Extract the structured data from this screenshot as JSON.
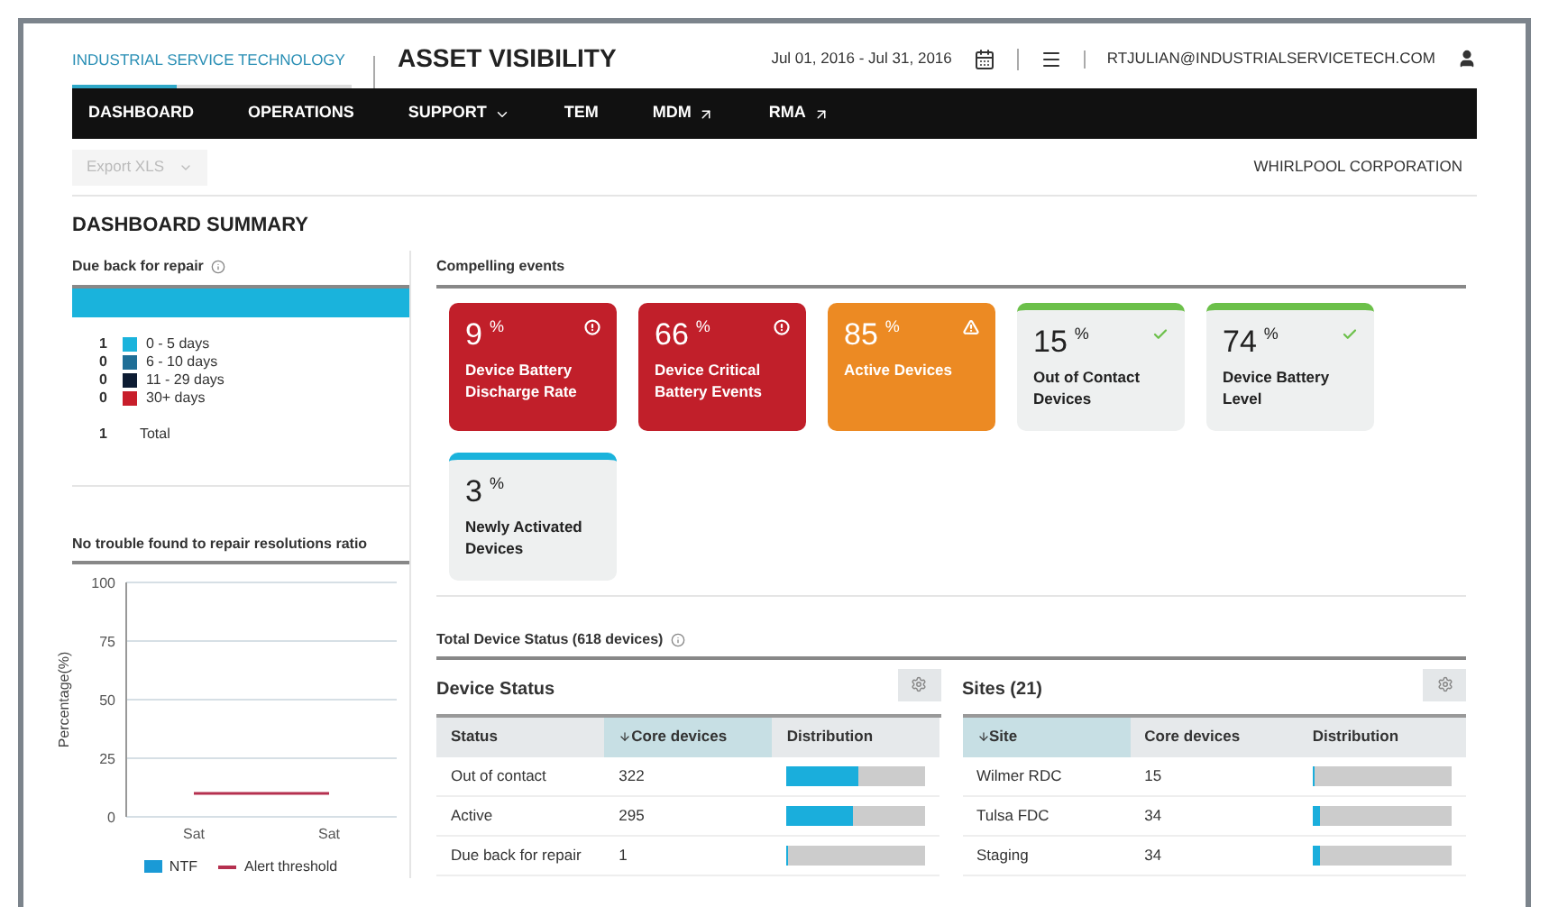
{
  "header": {
    "brand": "INDUSTRIAL SERVICE TECHNOLOGY",
    "title": "ASSET VISIBILITY",
    "date_range": "Jul 01, 2016 - Jul 31, 2016",
    "user": "RTJULIAN@INDUSTRIALSERVICETECH.COM"
  },
  "nav": [
    {
      "label": "DASHBOARD",
      "kind": "plain"
    },
    {
      "label": "OPERATIONS",
      "kind": "plain"
    },
    {
      "label": "SUPPORT",
      "kind": "dropdown"
    },
    {
      "label": "TEM",
      "kind": "plain"
    },
    {
      "label": "MDM",
      "kind": "external"
    },
    {
      "label": "RMA",
      "kind": "external"
    }
  ],
  "export": {
    "label": "Export XLS",
    "disabled": true
  },
  "company": "WHIRLPOOL CORPORATION",
  "summary_title": "DASHBOARD SUMMARY",
  "due_back": {
    "title": "Due back for repair",
    "legend": [
      {
        "count": "1",
        "label": "0 - 5 days",
        "color": "#1ab3dc"
      },
      {
        "count": "0",
        "label": "6 - 10 days",
        "color": "#1f6e96"
      },
      {
        "count": "0",
        "label": "11 - 29 days",
        "color": "#0d1c33"
      },
      {
        "count": "0",
        "label": "30+ days",
        "color": "#c81e2b"
      }
    ],
    "total_count": "1",
    "total_label": "Total"
  },
  "ntf": {
    "title": "No trouble found to repair resolutions ratio",
    "chart_data": {
      "type": "line",
      "ylabel": "Percentage(%)",
      "categories": [
        "Sat",
        "Sat"
      ],
      "ylim": [
        0,
        100
      ],
      "grid": true,
      "yticks": [
        0,
        25,
        50,
        75,
        100
      ],
      "series": [
        {
          "name": "NTF",
          "color": "#1a9ad6",
          "values": [
            null,
            null
          ]
        },
        {
          "name": "Alert threshold",
          "color": "#b5304f",
          "values": [
            10,
            10
          ]
        }
      ]
    }
  },
  "compelling": {
    "title": "Compelling events",
    "cards": [
      {
        "value": "9",
        "unit": "%",
        "label": "Device Battery Discharge Rate",
        "kind": "critical"
      },
      {
        "value": "66",
        "unit": "%",
        "label": "Device Critical Battery Events",
        "kind": "critical"
      },
      {
        "value": "85",
        "unit": "%",
        "label": "Active Devices",
        "kind": "warning"
      },
      {
        "value": "15",
        "unit": "%",
        "label": "Out of Contact Devices",
        "kind": "ok"
      },
      {
        "value": "74",
        "unit": "%",
        "label": "Device Battery Level",
        "kind": "ok"
      },
      {
        "value": "3",
        "unit": "%",
        "label": "Newly Activated Devices",
        "kind": "new"
      }
    ]
  },
  "total_status": {
    "title": "Total Device Status (618 devices)"
  },
  "tables": [
    {
      "title": "Device Status",
      "columns": [
        {
          "label": "Status",
          "sorted": false
        },
        {
          "label": "Core devices",
          "sorted": true
        },
        {
          "label": "Distribution",
          "sorted": false
        }
      ],
      "rows": [
        {
          "name": "Out of contact",
          "count": "322",
          "level": 0.51
        },
        {
          "name": "Active",
          "count": "295",
          "level": 0.47
        },
        {
          "name": "Due back for repair",
          "count": "1",
          "level": 0.005
        }
      ]
    },
    {
      "title": "Sites (21)",
      "columns": [
        {
          "label": "Site",
          "sorted": true
        },
        {
          "label": "Core devices",
          "sorted": false
        },
        {
          "label": "Distribution",
          "sorted": false
        }
      ],
      "rows": [
        {
          "name": "Wilmer RDC",
          "count": "15",
          "level": 0.02
        },
        {
          "name": "Tulsa FDC",
          "count": "34",
          "level": 0.05
        },
        {
          "name": "Staging",
          "count": "34",
          "level": 0.05
        }
      ]
    }
  ]
}
